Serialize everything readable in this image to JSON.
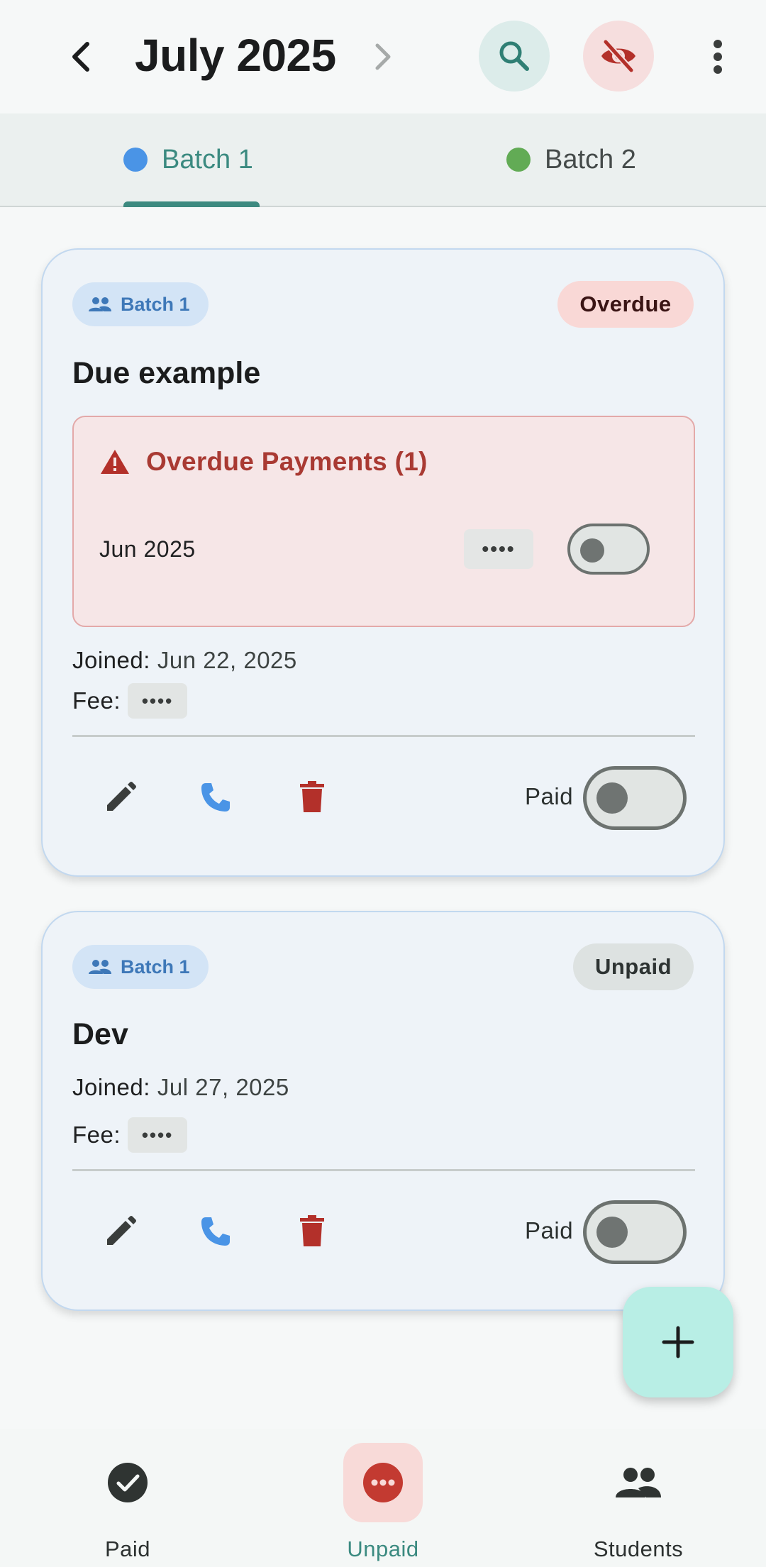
{
  "header": {
    "title": "July 2025",
    "back_icon": "chevron-left-icon",
    "next_icon": "chevron-right-icon",
    "search_icon": "search-icon",
    "visibility_icon": "eye-off-icon",
    "more_icon": "more-vert-icon"
  },
  "tabs": [
    {
      "label": "Batch 1",
      "dot_color": "#4a94e6",
      "selected": true
    },
    {
      "label": "Batch 2",
      "dot_color": "#62ab55",
      "selected": false
    }
  ],
  "cards": [
    {
      "batch": "Batch 1",
      "status": "Overdue",
      "name": "Due example",
      "overdue": {
        "title": "Overdue Payments (1)",
        "items": [
          {
            "month": "Jun 2025",
            "amount": "••••",
            "paid": false
          }
        ]
      },
      "joined_label": "Joined:",
      "joined_value": "Jun 22, 2025",
      "fee_label": "Fee:",
      "fee_value": "••••",
      "paid_label": "Paid",
      "paid": false
    },
    {
      "batch": "Batch 1",
      "status": "Unpaid",
      "name": "Dev",
      "joined_label": "Joined:",
      "joined_value": "Jul 27, 2025",
      "fee_label": "Fee:",
      "fee_value": "••••",
      "paid_label": "Paid",
      "paid": false
    }
  ],
  "fab": {
    "icon": "plus-icon"
  },
  "bottom_nav": [
    {
      "label": "Paid",
      "icon": "check-circle-icon",
      "selected": false
    },
    {
      "label": "Unpaid",
      "icon": "more-horiz-circle-icon",
      "selected": true
    },
    {
      "label": "Students",
      "icon": "people-icon",
      "selected": false
    }
  ],
  "colors": {
    "accent": "#3d8a80",
    "overdue_text": "#a93a33",
    "batch_chip": "#d3e4f6",
    "call_icon": "#4a94e6",
    "delete_icon": "#b3302a",
    "fab": "#b8eee5"
  }
}
